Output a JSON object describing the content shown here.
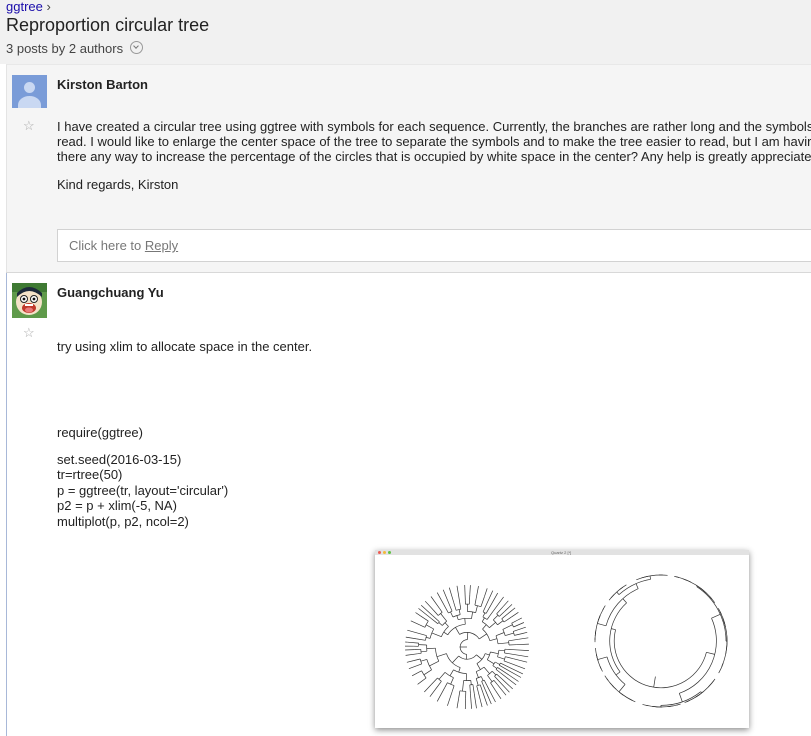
{
  "breadcrumb": {
    "group": "ggtree",
    "separator": "›"
  },
  "thread": {
    "title": "Reproportion circular tree",
    "meta": "3 posts by 2 authors"
  },
  "posts": [
    {
      "author": "Kirston Barton",
      "paragraphs": [
        "I have created a circular tree using ggtree with symbols for each sequence. Currently, the branches are rather long and the symbols",
        "read. I would like to enlarge the center space of the tree to separate the symbols and to make the tree easier to read, but I am havir",
        "there any way to increase the percentage of the circles that is occupied by white space in the center? Any help is greatly appreciate"
      ],
      "signoff": "Kind regards, Kirston",
      "reply": {
        "prefix": "Click here to ",
        "link": "Reply"
      }
    },
    {
      "author": "Guangchuang Yu",
      "text": "try using xlim to allocate space in the center.",
      "code": [
        "require(ggtree)",
        "set.seed(2016-03-15)",
        "tr=rtree(50)",
        "p = ggtree(tr, layout='circular')",
        "p2 = p + xlim(-5, NA)",
        "multiplot(p, p2, ncol=2)"
      ],
      "image": {
        "window_title": "Quartz 2 [*]"
      }
    }
  ],
  "icons": {
    "star": "star-icon",
    "expand": "chevron-down-icon",
    "avatar": "avatar-icon"
  },
  "colors": {
    "link": "#1a0dab",
    "header_bg": "#f1f1f1",
    "post_bg": "#f5f5f5"
  }
}
